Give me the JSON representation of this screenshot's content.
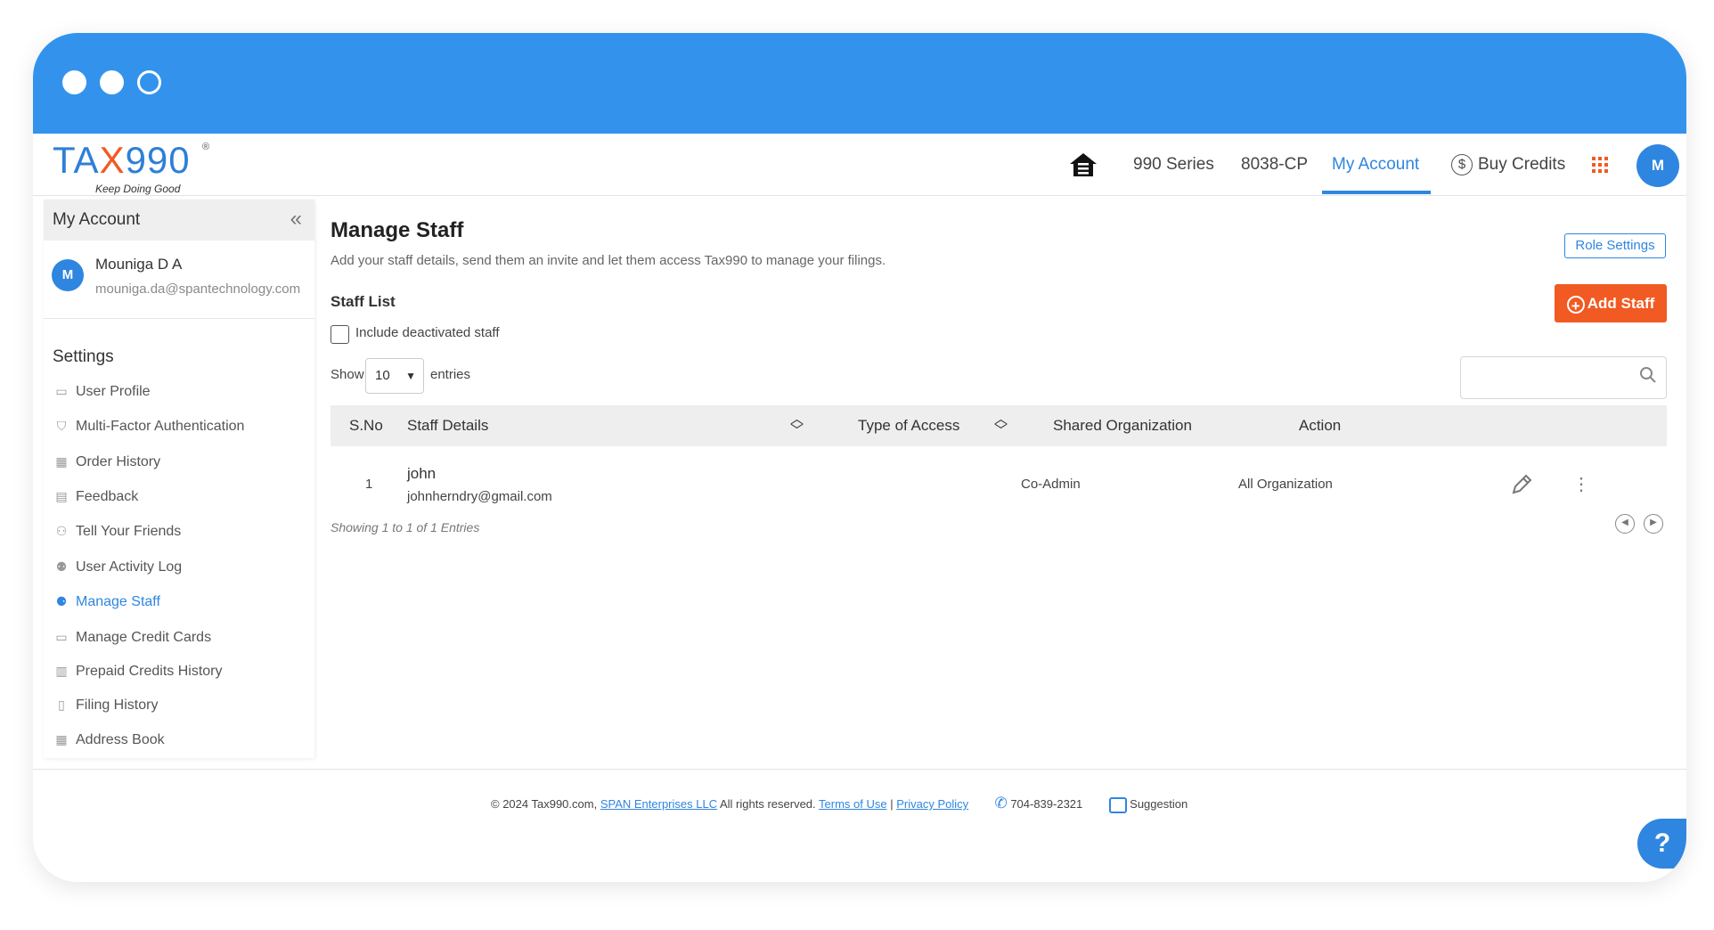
{
  "logo": {
    "brand_a": "TA",
    "brand_x": "X",
    "brand_b": "990",
    "registered": "®",
    "tagline": "Keep Doing Good"
  },
  "nav": {
    "home_icon": "home-icon",
    "series": "990 Series",
    "form": "8038-CP",
    "account": "My Account",
    "buy_credits": "Buy Credits",
    "apps_icon": "grid-icon",
    "avatar": "M"
  },
  "sidebar": {
    "title": "My Account",
    "collapse_icon": "«",
    "user": {
      "initial": "M",
      "name": "Mouniga D A",
      "email": "mouniga.da@spantechnology.com"
    },
    "settings_title": "Settings",
    "items": [
      {
        "label": "User Profile",
        "icon": "id-card-icon",
        "active": false
      },
      {
        "label": "Multi-Factor Authentication",
        "icon": "shield-icon",
        "active": false
      },
      {
        "label": "Order History",
        "icon": "calendar-icon",
        "active": false
      },
      {
        "label": "Feedback",
        "icon": "feedback-icon",
        "active": false
      },
      {
        "label": "Tell Your Friends",
        "icon": "users-icon",
        "active": false
      },
      {
        "label": "User Activity Log",
        "icon": "activity-icon",
        "active": false
      },
      {
        "label": "Manage Staff",
        "icon": "team-icon",
        "active": true
      },
      {
        "label": "Manage Credit Cards",
        "icon": "card-icon",
        "active": false
      },
      {
        "label": "Prepaid Credits History",
        "icon": "coins-icon",
        "active": false
      },
      {
        "label": "Filing History",
        "icon": "file-clock-icon",
        "active": false
      },
      {
        "label": "Address Book",
        "icon": "book-icon",
        "active": false
      }
    ]
  },
  "main": {
    "title": "Manage Staff",
    "subtitle": "Add your staff details, send them an invite and let them access Tax990 to manage your filings.",
    "role_settings": "Role Settings",
    "staff_list": "Staff List",
    "add_staff": "Add Staff",
    "include_deactivated": "Include deactivated staff",
    "show": "Show",
    "entries_value": "10",
    "entries": "entries",
    "search_placeholder": "",
    "table": {
      "headers": [
        "S.No",
        "Staff Details",
        "Type of Access",
        "Shared Organization",
        "Action"
      ],
      "rows": [
        {
          "sno": "1",
          "name": "john",
          "email": "johnherndry@gmail.com",
          "access": "Co-Admin",
          "org": "All Organization"
        }
      ]
    },
    "showing": "Showing 1 to 1 of 1 Entries"
  },
  "footer": {
    "copyright": "© 2024 Tax990.com,",
    "company": "SPAN Enterprises LLC",
    "rights": "All rights reserved.",
    "terms": "Terms of Use",
    "sep": "|",
    "privacy": "Privacy Policy",
    "phone": "704-839-2321",
    "suggestion": "Suggestion"
  },
  "help": "?"
}
